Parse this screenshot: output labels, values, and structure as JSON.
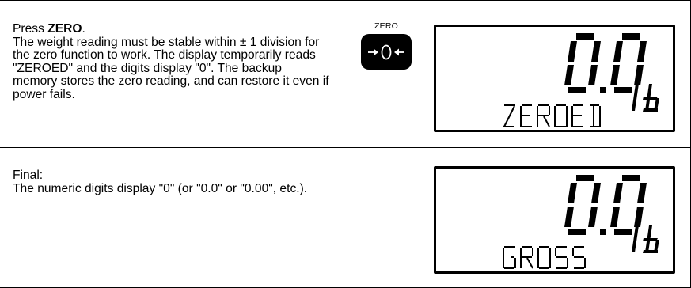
{
  "rows": [
    {
      "title_prefix": "Press ",
      "title_bold": "ZERO",
      "title_suffix": ".",
      "text": "The weight reading must be stable within ± 1 division for the zero function to work. The display temporarily reads \"ZEROED\" and the digits display \"0\". The backup memory stores the zero reading, and can restore it even if power fails.",
      "key": {
        "caption": "ZERO",
        "symbol": "→0←",
        "icon": "zero-key-icon"
      },
      "display": {
        "digits": "0.0",
        "unit": "lb",
        "message": "ZEROED"
      }
    },
    {
      "title_prefix": "Final:",
      "title_bold": "",
      "title_suffix": "",
      "text": "The numeric digits display \"0\" (or \"0.0\" or \"0.00\", etc.).",
      "display": {
        "digits": "0.0",
        "unit": "lb",
        "message": "GROSS"
      }
    }
  ]
}
